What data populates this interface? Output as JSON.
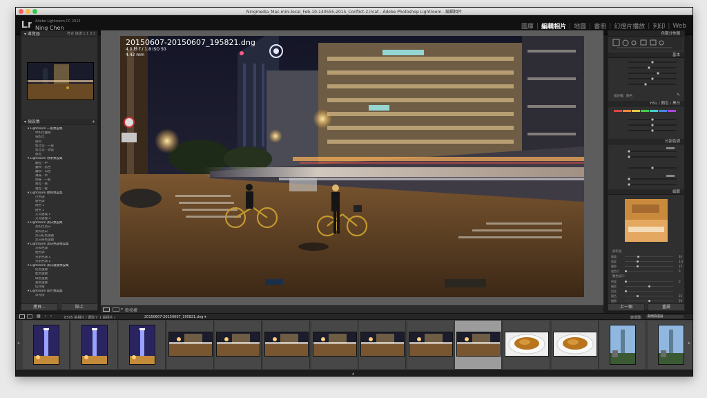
{
  "window": {
    "title": "Ningmedia_Mac-mini.local_Feb-10-140555-2015_Conflict-2.lrcat - Adobe Photoshop Lightroom - 編輯相片"
  },
  "identity": {
    "logo": "Lr",
    "app_name": "Adobe Lightroom CC 2015",
    "user_name": "Ning Chen"
  },
  "modules": [
    {
      "label": "圖庫",
      "active": false
    },
    {
      "label": "編輯相片",
      "active": true
    },
    {
      "label": "地圖",
      "active": false
    },
    {
      "label": "書冊",
      "active": false
    },
    {
      "label": "幻燈片播放",
      "active": false
    },
    {
      "label": "列印",
      "active": false
    },
    {
      "label": "Web",
      "active": false
    }
  ],
  "left_panel": {
    "navigator_title": "導覽器",
    "navigator_tools": "符合  填滿  1:1  3:1",
    "presets_title": "預設集",
    "presets": [
      {
        "label": "Lightroom 一般預設集",
        "folder": true
      },
      {
        "label": "中對比曲線",
        "folder": false
      },
      {
        "label": "強對比",
        "folder": false
      },
      {
        "label": "銳利",
        "folder": false
      },
      {
        "label": "對比化 - 一般",
        "folder": false
      },
      {
        "label": "對比化 - 適當",
        "folder": false
      },
      {
        "label": "銳化",
        "folder": false
      },
      {
        "label": "Lightroom 效果預設集",
        "folder": true
      },
      {
        "label": "顆粒 - 中",
        "folder": false
      },
      {
        "label": "暈映 - 黑色",
        "folder": false
      },
      {
        "label": "暈映 - 白色",
        "folder": false
      },
      {
        "label": "薄霧 - 中",
        "folder": false
      },
      {
        "label": "除霧 - 一般",
        "folder": false
      },
      {
        "label": "粗粒 - 重",
        "folder": false
      },
      {
        "label": "粗粒 - 輕",
        "folder": false
      },
      {
        "label": "Lightroom 顏色預設集",
        "folder": true
      },
      {
        "label": "冷色調",
        "folder": false
      },
      {
        "label": "暖色調",
        "folder": false
      },
      {
        "label": "褪色 1",
        "folder": false
      },
      {
        "label": "褪色 2",
        "folder": false
      },
      {
        "label": "交叉處理 1",
        "folder": false
      },
      {
        "label": "交叉處理 2",
        "folder": false
      },
      {
        "label": "Lightroom 黑白預設集",
        "folder": true
      },
      {
        "label": "高對比黑白",
        "folder": false
      },
      {
        "label": "柔和黑白",
        "folder": false
      },
      {
        "label": "黑白紅色濾鏡",
        "folder": false
      },
      {
        "label": "黑白綠色濾鏡",
        "folder": false
      },
      {
        "label": "Lightroom 黑白色調預設集",
        "folder": true
      },
      {
        "label": "深褐色調",
        "folder": false
      },
      {
        "label": "硒色調",
        "folder": false
      },
      {
        "label": "分割色調 1",
        "folder": false
      },
      {
        "label": "分割色調 2",
        "folder": false
      },
      {
        "label": "Lightroom 黑白濾鏡預設集",
        "folder": true
      },
      {
        "label": "紅色濾鏡",
        "folder": false
      },
      {
        "label": "藍色濾鏡",
        "folder": false
      },
      {
        "label": "綠色濾鏡",
        "folder": false
      },
      {
        "label": "黃色濾鏡",
        "folder": false
      },
      {
        "label": "紅外線",
        "folder": false
      },
      {
        "label": "Lightroom 影片預設集",
        "folder": true
      },
      {
        "label": "日光燈",
        "folder": false
      }
    ],
    "copy_label": "拷貝...",
    "paste_label": "貼上"
  },
  "photo": {
    "filename": "20150607-20150607_195821.dng",
    "exif": "4.0 秒 f / 1.8  ISO 50",
    "size": "4.42 mm"
  },
  "toolbar": {
    "softproof_label": "軟校樣"
  },
  "right_panel": {
    "histogram_title": "色階分佈圖",
    "basic_title": "基本",
    "profile_label": "描述檔：顏色",
    "hsl_tabs": "HSL / 顏色 / 黑白",
    "split_title": "分割色調",
    "detail_title": "細節",
    "sharpen_sliders": [
      {
        "label": "總量",
        "value": "40",
        "fraction": 0.27
      },
      {
        "label": "強度",
        "value": "1.0",
        "fraction": 0.25
      },
      {
        "label": "細節",
        "value": "25",
        "fraction": 0.25
      },
      {
        "label": "遮色片",
        "value": "0",
        "fraction": 0.0
      }
    ],
    "noise_label": "雜色減少",
    "noise_sliders": [
      {
        "label": "明度",
        "value": "0",
        "fraction": 0.0
      },
      {
        "label": "細節",
        "value": "",
        "fraction": 0.5
      },
      {
        "label": "對比",
        "value": "",
        "fraction": 0.0
      },
      {
        "label": "顏色",
        "value": "25",
        "fraction": 0.25
      },
      {
        "label": "細節",
        "value": "50",
        "fraction": 0.5
      }
    ],
    "prev_label": "上一個",
    "reset_label": "重設"
  },
  "filmstrip": {
    "info": "8395 張相片 / 選取了 1 張相片 /",
    "path": "20150607-20150607_195821.dng ▾",
    "filter_label": "篩選器：",
    "filter_value": "關閉篩選器",
    "cells": [
      {
        "kind": "tower"
      },
      {
        "kind": "tower"
      },
      {
        "kind": "tower"
      },
      {
        "kind": "street"
      },
      {
        "kind": "street"
      },
      {
        "kind": "street"
      },
      {
        "kind": "street"
      },
      {
        "kind": "street"
      },
      {
        "kind": "street"
      },
      {
        "kind": "street"
      },
      {
        "kind": "food"
      },
      {
        "kind": "food"
      },
      {
        "kind": "daytower"
      },
      {
        "kind": "daytower"
      }
    ],
    "selected_index": 9
  },
  "colors": {
    "accent": "#f2f2f2",
    "panel_bg": "#2f2f2f",
    "selected_cell": "#9c9c9c"
  }
}
